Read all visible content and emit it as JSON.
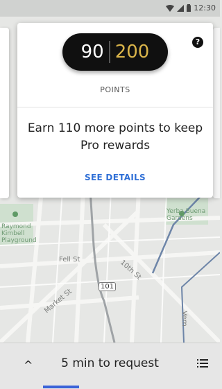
{
  "status_bar": {
    "time": "12:30",
    "icons": [
      "wifi-icon",
      "signal-icon",
      "battery-icon"
    ]
  },
  "map": {
    "streets": [
      "Fell St",
      "Market St",
      "101",
      "10th St",
      "Vern"
    ],
    "places": [
      "Yerba Buena Gardens",
      "Raymond Kimbell Playground"
    ]
  },
  "rewards_card": {
    "current_points": "90",
    "target_points": "200",
    "points_label": "POINTS",
    "message": "Earn 110 more points to keep Pro rewards",
    "details_link": "SEE DETAILS",
    "help_icon": "?"
  },
  "bottom_bar": {
    "expand_icon": "^",
    "request_text": "5 min to request",
    "menu_icon": "list-icon"
  },
  "colors": {
    "pill_background": "#101010",
    "target_points": "#d9b44a",
    "link": "#2f6fd6",
    "accent_bar": "#3a63d8"
  }
}
